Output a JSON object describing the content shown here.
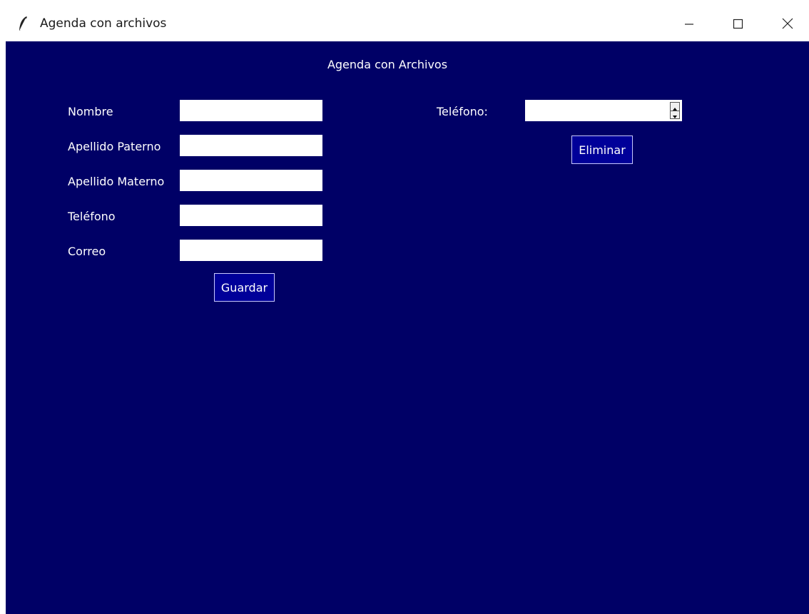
{
  "window": {
    "title": "Agenda con archivos"
  },
  "main": {
    "heading": "Agenda con Archivos"
  },
  "form": {
    "fields": [
      {
        "label": "Nombre",
        "value": ""
      },
      {
        "label": "Apellido Paterno",
        "value": ""
      },
      {
        "label": "Apellido Materno",
        "value": ""
      },
      {
        "label": "Teléfono",
        "value": ""
      },
      {
        "label": "Correo",
        "value": ""
      }
    ],
    "save_label": "Guardar"
  },
  "delete_panel": {
    "phone_label": "Teléfono:",
    "phone_value": "",
    "delete_label": "Eliminar"
  },
  "colors": {
    "background": "#000066",
    "button": "#000099",
    "text": "#ffffff"
  }
}
